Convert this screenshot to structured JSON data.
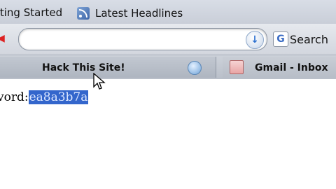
{
  "bookmarks": {
    "getting_started": "tting Started",
    "latest_headlines": "Latest Headlines"
  },
  "navbar": {
    "url_value": "",
    "search_label": "Search"
  },
  "tabs": [
    {
      "label": "Hack This Site!",
      "active": true
    },
    {
      "label": "Gmail - Inbox",
      "active": false
    }
  ],
  "content": {
    "password_label": "vord:",
    "password_value": "ea8a3b7a"
  },
  "icons": {
    "rss": "rss-icon",
    "go": "go-arrow-icon",
    "search_engine": "google-icon",
    "tab_reload": "tab-reload-icon",
    "gmail": "gmail-icon",
    "cursor": "mouse-cursor-icon"
  },
  "colors": {
    "selection": "#3366cc",
    "tab_active": "#c2c8d1"
  }
}
